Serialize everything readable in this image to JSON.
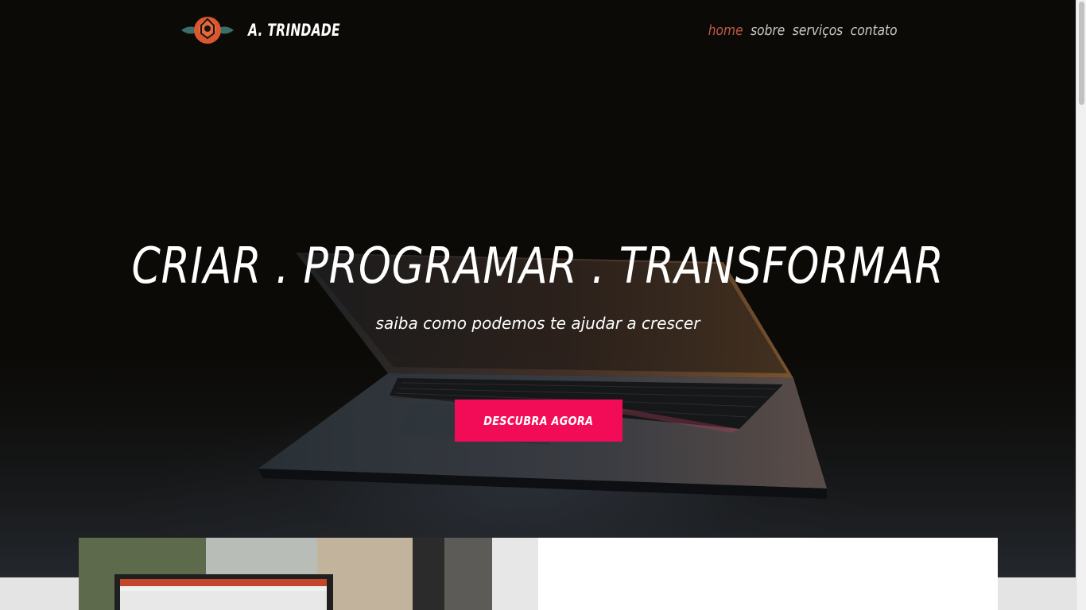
{
  "header": {
    "brand": "A. TRINDADE",
    "logo_icon": "rose-logo-icon",
    "nav": [
      {
        "label": "home",
        "active": true
      },
      {
        "label": "sobre",
        "active": false
      },
      {
        "label": "serviços",
        "active": false
      },
      {
        "label": "contato",
        "active": false
      }
    ]
  },
  "hero": {
    "headline": "CRIAR . PROGRAMAR . TRANSFORMAR",
    "subline": "saiba como podemos te ajudar a crescer",
    "cta_label": "DESCUBRA AGORA",
    "background_image": "laptop-on-desk"
  },
  "colors": {
    "accent": "#f20c57",
    "nav_active": "#c0594a",
    "hero_bg": "#0b0a07"
  }
}
